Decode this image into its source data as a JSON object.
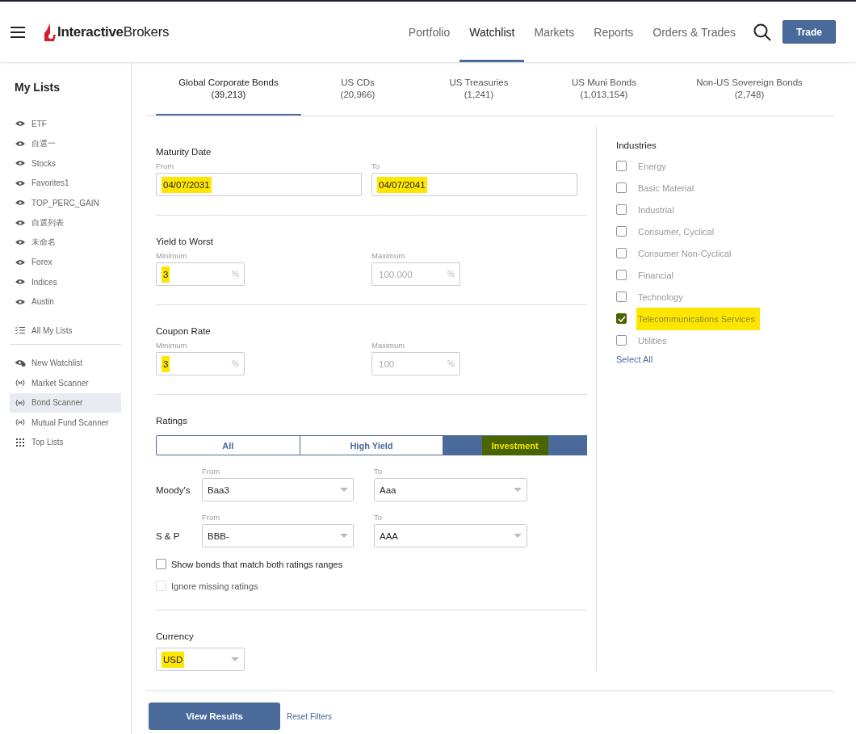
{
  "header": {
    "logo": "**Interactive**Brokers",
    "nav": [
      {
        "label": "Portfolio",
        "selected": false
      },
      {
        "label": "Watchlist",
        "selected": true
      },
      {
        "label": "Markets",
        "selected": false
      },
      {
        "label": "Reports",
        "selected": false
      },
      {
        "label": "Orders & Trades",
        "selected": false
      }
    ],
    "trade_button": "Trade"
  },
  "sidebar": {
    "title": "My Lists",
    "groups": [
      [
        {
          "label": "ETF",
          "kind": "list",
          "selected": false
        },
        {
          "label": "自選一",
          "kind": "list",
          "selected": false
        },
        {
          "label": "Stocks",
          "kind": "list",
          "selected": false
        },
        {
          "label": "Favorites1",
          "kind": "list",
          "selected": false
        },
        {
          "label": "TOP_PERC_GAIN",
          "kind": "list",
          "selected": false
        },
        {
          "label": "自選列表",
          "kind": "list",
          "selected": false
        },
        {
          "label": "未命名",
          "kind": "list",
          "selected": false
        },
        {
          "label": "Forex",
          "kind": "list",
          "selected": false
        },
        {
          "label": "Indices",
          "kind": "list",
          "selected": false
        },
        {
          "label": "Austin",
          "kind": "list",
          "selected": false
        }
      ],
      [
        {
          "label": "All My Lists",
          "kind": "all",
          "selected": false
        }
      ],
      [
        {
          "label": "New Watchlist",
          "kind": "new",
          "selected": false
        },
        {
          "label": "Market Scanner",
          "kind": "scanner",
          "selected": false
        },
        {
          "label": "Bond Scanner",
          "kind": "scanner",
          "selected": true
        },
        {
          "label": "Mutual Fund Scanner",
          "kind": "scanner",
          "selected": false
        },
        {
          "label": "Top Lists",
          "kind": "grid",
          "selected": false
        }
      ]
    ]
  },
  "tabs": [
    {
      "label": "Global Corporate Bonds",
      "count": "(39,213)",
      "selected": true
    },
    {
      "label": "US CDs",
      "count": "(20,966)",
      "selected": false
    },
    {
      "label": "US Treasuries",
      "count": "(1,241)",
      "selected": false
    },
    {
      "label": "US Muni Bonds",
      "count": "(1,013,154)",
      "selected": false
    },
    {
      "label": "Non-US Sovereign Bonds",
      "count": "(2,748)",
      "selected": false
    }
  ],
  "maturity_date": {
    "title": "Maturity Date",
    "from": {
      "label": "From",
      "value": "04/07/2031",
      "highlighted": true
    },
    "to": {
      "label": "To",
      "value": "04/07/2041",
      "highlighted": true
    }
  },
  "ranges": [
    {
      "title": "Yield to Worst",
      "min": {
        "label": "Minimum",
        "value": "3",
        "unit": "%",
        "highlighted": true
      },
      "max": {
        "label": "Maximum",
        "placeholder": "100.000",
        "unit": "%",
        "highlighted": false
      }
    },
    {
      "title": "Coupon Rate",
      "min": {
        "label": "Minimum",
        "value": "3",
        "unit": "%",
        "highlighted": true
      },
      "max": {
        "label": "Maximum",
        "placeholder": "100",
        "unit": "%",
        "highlighted": false
      }
    }
  ],
  "ratings": {
    "title": "Ratings",
    "segments": [
      {
        "label": "All",
        "selected": false,
        "highlighted": false
      },
      {
        "label": "High Yield",
        "selected": false,
        "highlighted": false
      },
      {
        "label": "Investment",
        "selected": true,
        "highlighted": true
      }
    ],
    "agencies": [
      {
        "name": "Moody's",
        "from_label": "From",
        "from": "Baa3",
        "to_label": "To",
        "to": "Aaa"
      },
      {
        "name": "S & P",
        "from_label": "From",
        "from": "BBB-",
        "to_label": "To",
        "to": "AAA"
      }
    ],
    "options": [
      {
        "label": "Show bonds that match both ratings ranges",
        "checked": false,
        "disabled": false
      },
      {
        "label": "Ignore missing ratings",
        "checked": false,
        "disabled": true
      }
    ]
  },
  "currency": {
    "title": "Currency",
    "value": "USD",
    "highlighted": true
  },
  "industries": {
    "title": "Industries",
    "items": [
      {
        "label": "Energy",
        "checked": false,
        "highlighted": false
      },
      {
        "label": "Basic Material",
        "checked": false,
        "highlighted": false
      },
      {
        "label": "Industrial",
        "checked": false,
        "highlighted": false
      },
      {
        "label": "Consumer, Cyclical",
        "checked": false,
        "highlighted": false
      },
      {
        "label": "Consumer Non-Cyclical",
        "checked": false,
        "highlighted": false
      },
      {
        "label": "Financial",
        "checked": false,
        "highlighted": false
      },
      {
        "label": "Technology",
        "checked": false,
        "highlighted": false
      },
      {
        "label": "Telecommunications Services",
        "checked": true,
        "highlighted": true
      },
      {
        "label": "Utilities",
        "checked": false,
        "highlighted": false
      }
    ],
    "select_all": "Select All"
  },
  "actions": {
    "primary": "View Results",
    "reset": "Reset Filters"
  }
}
